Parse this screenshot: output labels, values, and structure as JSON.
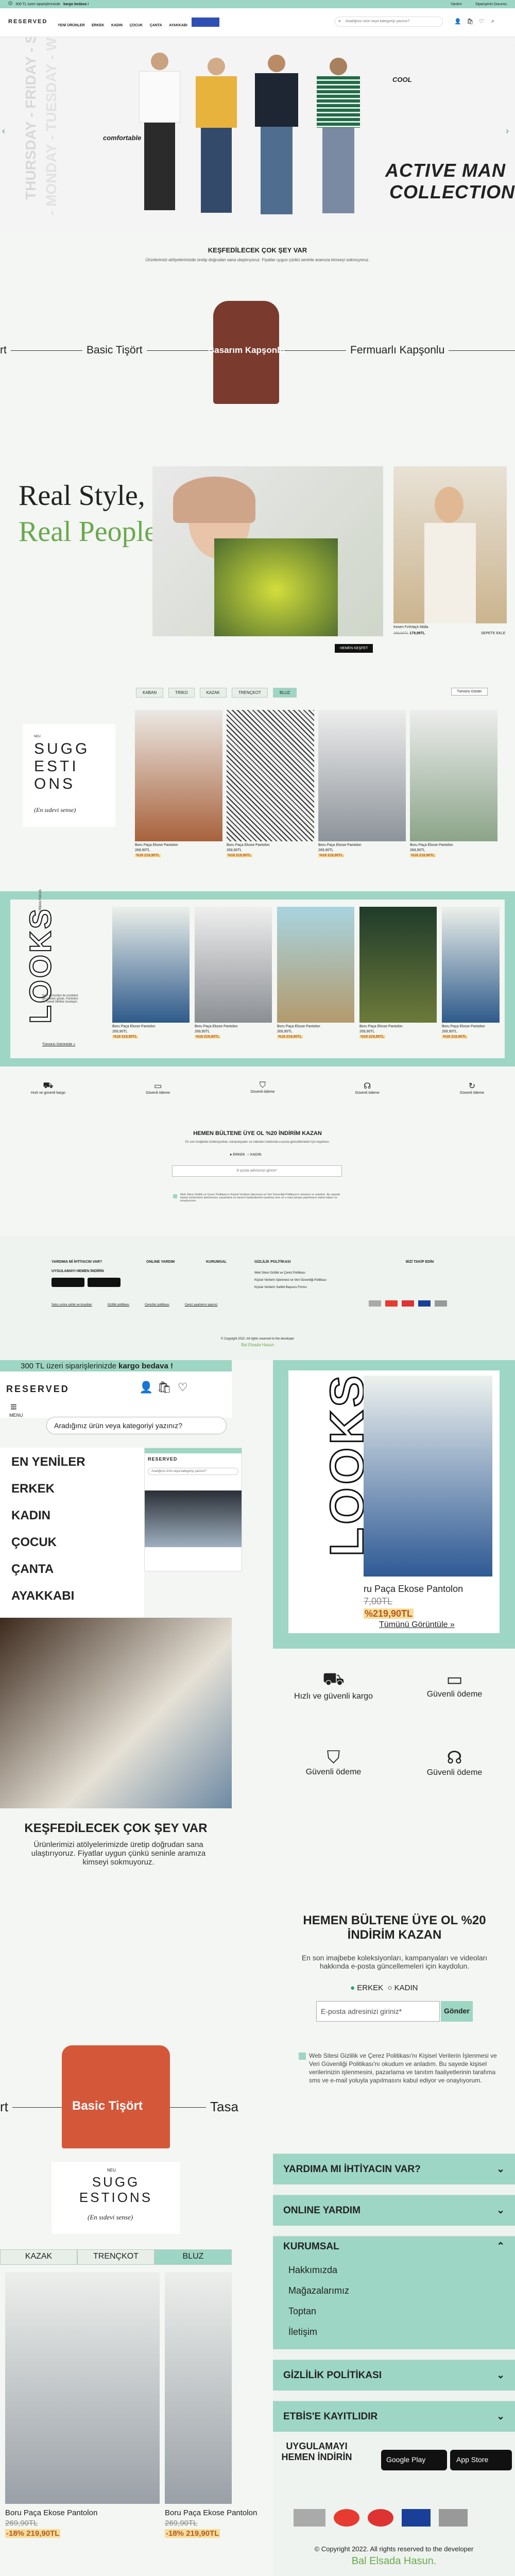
{
  "topbar": {
    "promo_prefix": "300 TL üzeri siparişlerinizde",
    "promo_bold": "kargo bedava !",
    "links": [
      "Yardım",
      "Siparişimin Durumu"
    ]
  },
  "header": {
    "logo": "RESERVED",
    "nav": [
      "YENİ ÜRÜNLER",
      "ERKEK",
      "KADIN",
      "ÇOCUK",
      "ÇANTA",
      "AYAKKABI"
    ],
    "search_placeholder": "Aradığınız ürün veya kategoriyi yazınız?"
  },
  "hero": {
    "title_line1": "ACTIVE MAN",
    "title_line2": "COLLECTION",
    "tag1": "comfortable",
    "tag2": "COOL",
    "side_text": "THURSDAY - FRIDAY - SATURDAY",
    "side_text2": "- MONDAY - TUESDAY - WEDNESDAY -"
  },
  "discover": {
    "title": "KEŞFEDİLECEK ÇOK ŞEY VAR",
    "subtitle": "Ürünlerimizi atölyelerimizde üretip doğrudan sana ulaştırıyoruz. Fiyatlar uygun çünkü seninle aramıza kimseyi sokmuyoruz."
  },
  "carousel": {
    "items": [
      "Basic Tişört",
      "Basarım Kapşonlu",
      "Fermuarlı Kapşonlu"
    ],
    "left_partial": "rt"
  },
  "real": {
    "line1": "Real Style,",
    "line2": "Real People",
    "product_name": "Kesen Fırfırlaçlı Midia",
    "old_price": "269,90TL",
    "new_price": "179,99TL",
    "button": "HEMEN KEŞFET",
    "caption": "SEPETE EKLE"
  },
  "suggestions": {
    "tabs": [
      "KABAN",
      "TRİKO",
      "KAZAK",
      "TRENÇKOT",
      "BLUZ"
    ],
    "active_tab": "BLUZ",
    "all_button": "Tümünü Göster",
    "small": "NEU",
    "title": [
      "SUGG",
      "ESTI",
      "ONS"
    ],
    "script": "(En sıdevi sense)"
  },
  "product_card": {
    "name": "Boru Paça Ekose Pantolon",
    "old_price": "269,90TL",
    "new_price": "%18 219,90TL"
  },
  "looks": {
    "brand": "LOOKS",
    "sub": "URBAN FOCUS",
    "desc": "Nerf atmosferi ile modelini gerçekten göste. Pantolon ve ceketi birlikte inceleyin.",
    "more": "Tümünü Görüntüle »",
    "card_name": "Boru Paça Ekose Pantolon",
    "card_old": "269,90TL",
    "card_new": "%18 219,90TL",
    "big_name": "ru Paça Ekose Pantolon",
    "big_old": "7,00TL",
    "big_new": "%219,90TL",
    "big_more": "Tümünü Görüntüle »"
  },
  "features": {
    "items": [
      "Hızlı ve güvenli kargo",
      "Güvenli ödeme",
      "Güvenli ödeme",
      "Güvenli ödeme",
      "Güvenli ödeme"
    ]
  },
  "newsletter": {
    "title": "HEMEN BÜLTENE ÜYE OL %20 İNDİRİM KAZAN",
    "text": "En son imajbebe koleksiyonları, kampanyaları ve videoları hakkında e-posta güncellemeleri için kaydolun.",
    "options": [
      "ERKEK",
      "KADIN"
    ],
    "placeholder": "E-posta adresinizi giriniz*",
    "submit": "Gönder",
    "consent": "Web Sitesi Gizlilik ve Çerez Politikası'nı Kişisel Verilerin İşlenmesi ve Veri Güvenliği Politikası'nı okudum ve anladım. Bu sayede kişisel verilerinizin işlenmesini, pazarlama ve tanıtım faaliyetlerinin tarafıma sms ve e-mail yoluyla yapılmasını kabul ediyor ve onaylıyorum."
  },
  "footer": {
    "cols": [
      "YARDIMA Mİ İHTİYACIN VAR?",
      "ONLINE YARDIM",
      "KURUMSAL",
      "GİZLİLİK POLİTİKASI",
      "BİZİ TAKİP EDİN"
    ],
    "col_items": [
      "Web Sitesi Gizlilik ve Çerez Politikası",
      "Kişisel Verilerin İşlenmesi ve Veri Güvenliği Politikası",
      "Kişisel Verilerin Sahibi Başvuru Formu"
    ],
    "apps": "UYGULAMAYI HEMEN İNDİRİN",
    "bottom_links": [
      "Satış sonra sahte ve koşulları",
      "Gizlilik politikası",
      "Çerezler politikası",
      "Çerez ayarlarını yapınız"
    ],
    "copyright": "© Copyright 2022. All rights reserved to the developer",
    "credit": "Bal Elsada Hasun"
  },
  "mobile": {
    "promo_prefix": "300 TL üzeri siparişlerinizde",
    "promo_bold": "kargo bedava !",
    "logo": "RESERVED",
    "menu_label": "MENU",
    "search_placeholder": "Aradığınız ürün veya kategoriyi yazınız?",
    "categories": [
      "EN YENİLER",
      "ERKEK",
      "KADIN",
      "ÇOCUK",
      "ÇANTA",
      "AYAKKABI"
    ],
    "discover_title": "KEŞFEDİLECEK ÇOK ŞEY VAR",
    "discover_text": "Ürünlerimizi atölyelerimizde üretip doğrudan sana ulaştırıyoruz. Fiyatlar uygun çünkü seninle aramıza kimseyi sokmuyoruz.",
    "carousel": [
      "rt",
      "Basic Tişört",
      "Tasa"
    ],
    "tabs": [
      "KAZAK",
      "TRENÇKOT",
      "BLUZ"
    ],
    "card_name": "Boru Paça Ekose Pantolon",
    "card_old": "269,90TL",
    "card_new": "-18% 219,90TL",
    "sugg_small": "NEU",
    "sugg_title": [
      "SUGG",
      "ESTIONS"
    ],
    "sugg_script": "(En sıdevi sense)"
  },
  "mobile_footer": {
    "rows": [
      "YARDIMA MI İHTİYACIN VAR?",
      "ONLINE YARDIM",
      "KURUMSAL",
      "GİZLİLİK POLİTİKASI",
      "ETBİS'E KAYITLIDIR"
    ],
    "kurumsal_items": [
      "Hakkımızda",
      "Mağazalarımız",
      "Toptan",
      "İletişim"
    ],
    "apps": "UYGULAMAYI HEMEN İNDİRİN",
    "google": "Google Play",
    "apple": "App Store",
    "copyright": "© Copyright 2022. All rights reserved to the developer",
    "credit": "Bal Elsada Hasun."
  },
  "colors": {
    "mint": "#9dd6c4",
    "green": "#6aa84f",
    "dark": "#222222",
    "sale": "#b9571f"
  }
}
